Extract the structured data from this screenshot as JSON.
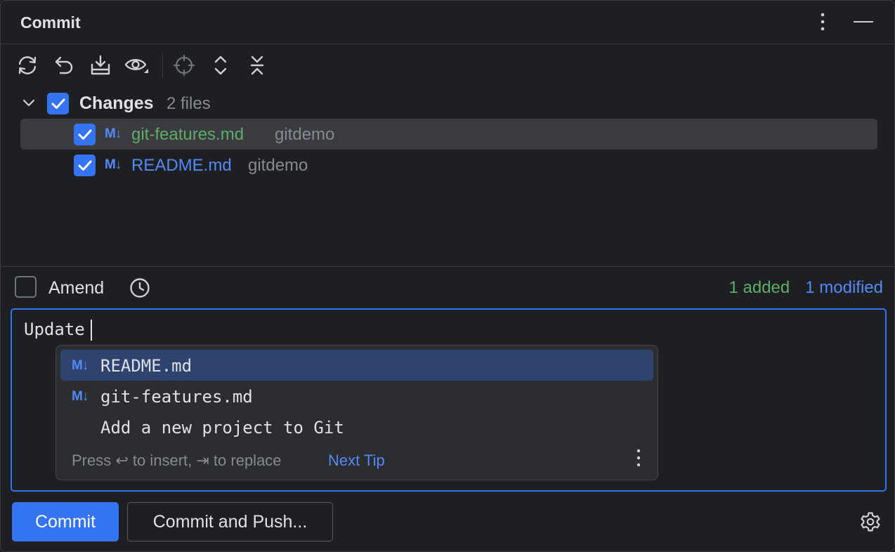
{
  "header": {
    "title": "Commit",
    "more_icon": "vertical-dots-icon",
    "minimize_icon": "minimize-icon"
  },
  "toolbar": {
    "icons": [
      "refresh-icon",
      "rollback-icon",
      "shelve-icon",
      "show-diff-icon",
      "locate-icon",
      "expand-all-icon",
      "collapse-all-icon"
    ]
  },
  "changes": {
    "group_label": "Changes",
    "group_count": "2 files",
    "files": [
      {
        "badge": "M↓",
        "name": "git-features.md",
        "dir": "gitdemo",
        "status": "added"
      },
      {
        "badge": "M↓",
        "name": "README.md",
        "dir": "gitdemo",
        "status": "modified"
      }
    ]
  },
  "amend": {
    "label": "Amend"
  },
  "stats": {
    "added": "1 added",
    "modified": "1 modified"
  },
  "editor": {
    "message": "Update"
  },
  "completion": {
    "items": [
      {
        "badge": "M↓",
        "text": "README.md"
      },
      {
        "badge": "M↓",
        "text": "git-features.md"
      },
      {
        "badge": "",
        "text": "Add a new project to Git"
      }
    ],
    "hint": "Press ↩ to insert, ⇥ to replace",
    "next_tip": "Next Tip"
  },
  "actions": {
    "commit": "Commit",
    "commit_and_push": "Commit and Push..."
  },
  "colors": {
    "accent": "#3574f0",
    "added": "#5fad65",
    "modified": "#548af7",
    "background": "#1e1f22"
  }
}
